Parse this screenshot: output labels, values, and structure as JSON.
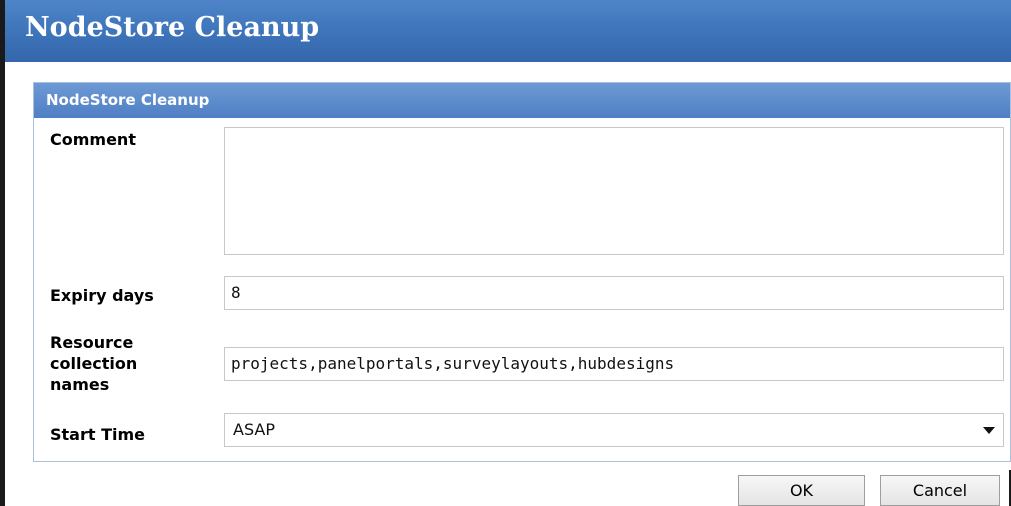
{
  "window": {
    "title": "NodeStore Cleanup"
  },
  "panel": {
    "title": "NodeStore Cleanup"
  },
  "fields": {
    "comment": {
      "label": "Comment",
      "value": ""
    },
    "expiry_days": {
      "label": "Expiry days",
      "value": "8"
    },
    "resource_collection_names": {
      "label_lines": [
        "Resource",
        "collection",
        "names"
      ],
      "value": "projects,panelportals,surveylayouts,hubdesigns"
    },
    "start_time": {
      "label": "Start Time",
      "value": "ASAP"
    }
  },
  "buttons": {
    "ok_label": "OK",
    "cancel_label": "Cancel"
  },
  "colors": {
    "titlebar": "#3f76bc",
    "panel_header": "#5a88c9",
    "panel_border": "#aac0de",
    "input_border": "#c8c8c8"
  },
  "icons": {
    "select_arrow": "chevron-down-icon"
  }
}
